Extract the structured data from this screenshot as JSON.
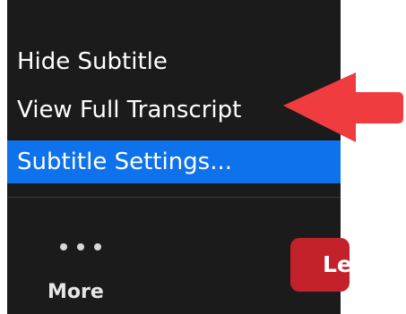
{
  "menu": {
    "items": [
      {
        "label": "Hide Subtitle"
      },
      {
        "label": "View Full Transcript"
      },
      {
        "label": "Subtitle Settings..."
      }
    ]
  },
  "toolbar": {
    "more_label": "More",
    "leave_label": "Le"
  },
  "icons": {
    "more": "ellipsis-icon",
    "callout": "red-arrow"
  },
  "colors": {
    "background": "#1b1b1b",
    "selection": "#0e72ed",
    "leave": "#c4222b",
    "arrow": "#f03b3f"
  }
}
